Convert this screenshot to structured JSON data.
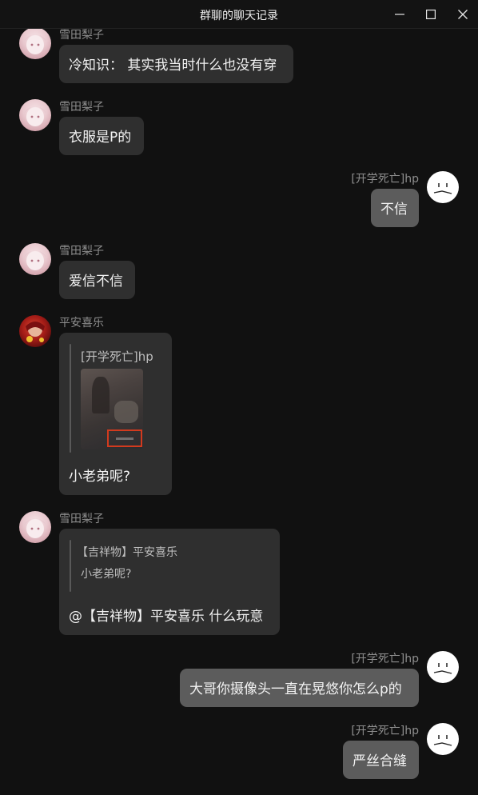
{
  "window": {
    "title": "群聊的聊天记录",
    "controls": {
      "minimize": "minimize-icon",
      "maximize": "maximize-icon",
      "close": "close-icon"
    }
  },
  "messages": [
    {
      "sender": "雪田梨子",
      "side": "left",
      "avatar": "girl",
      "text": "冷知识： 其实我当时什么也没有穿"
    },
    {
      "sender": "雪田梨子",
      "side": "left",
      "avatar": "girl",
      "text": "衣服是P的"
    },
    {
      "sender": "[开学死亡]hp",
      "side": "right",
      "avatar": "face",
      "text": "不信"
    },
    {
      "sender": "雪田梨子",
      "side": "left",
      "avatar": "girl",
      "text": "爱信不信"
    },
    {
      "sender": "平安喜乐",
      "side": "left",
      "avatar": "red",
      "quote": {
        "name": "[开学死亡]hp",
        "image": "photo-thumbnail"
      },
      "text": "小老弟呢?"
    },
    {
      "sender": "雪田梨子",
      "side": "left",
      "avatar": "girl",
      "quote": {
        "name": "【吉祥物】平安喜乐",
        "text": "小老弟呢?"
      },
      "text": "@【吉祥物】平安喜乐 什么玩意"
    },
    {
      "sender": "[开学死亡]hp",
      "side": "right",
      "avatar": "face",
      "text": "大哥你摄像头一直在晃悠你怎么p的"
    },
    {
      "sender": "[开学死亡]hp",
      "side": "right",
      "avatar": "face",
      "text": "严丝合缝"
    }
  ],
  "colors": {
    "background": "#111111",
    "bubble_left": "#2f2f2f",
    "bubble_right": "#5c5c5c",
    "name_text": "#8e8e8e"
  }
}
